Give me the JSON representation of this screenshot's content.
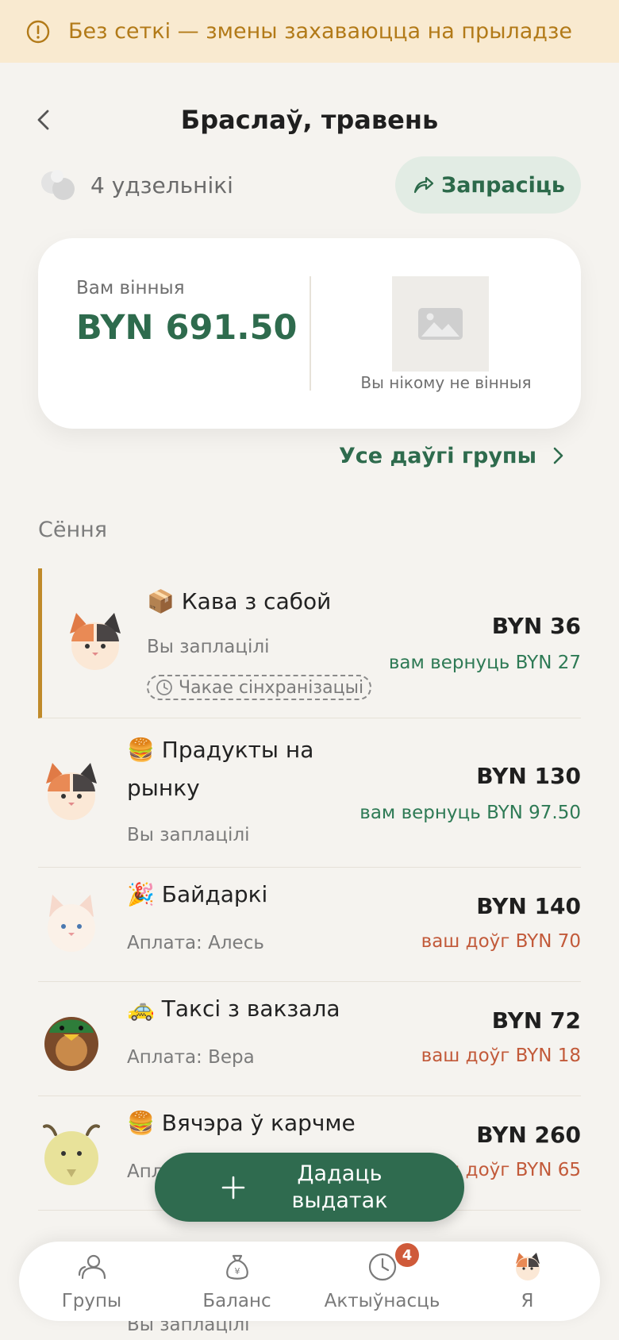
{
  "banner": {
    "text": "Без сеткі — змены захаваюцца на прыладзе"
  },
  "header": {
    "title": "Браслаў, травень"
  },
  "members": {
    "count_label": "4 удзельнікі",
    "invite_label": "Запрасіць"
  },
  "balance": {
    "owed_label": "Вам вінныя",
    "owed_amount": "BYN 691.50",
    "owe_nobody": "Вы нікому не вінныя"
  },
  "all_debts_label": "Усе даўгі групы",
  "section_today": "Сёння",
  "expenses": [
    {
      "emoji": "📦",
      "title": "Кава з сабой",
      "sub": "Вы заплацілі",
      "amount": "BYN 36",
      "delta": "вам вернуць BYN 27",
      "delta_type": "green",
      "status": "Чакае сінхранізацыі",
      "avatar": "calico-cat"
    },
    {
      "emoji": "🍔",
      "title": "Прадукты на рынку",
      "sub": "Вы заплацілі",
      "amount": "BYN 130",
      "delta": "вам вернуць BYN 97.50",
      "delta_type": "green",
      "avatar": "calico-cat"
    },
    {
      "emoji": "🎉",
      "title": "Байдаркі",
      "sub": "Аплата: Алесь",
      "amount": "BYN 140",
      "delta": "ваш доўг BYN 70",
      "delta_type": "red",
      "avatar": "white-cat"
    },
    {
      "emoji": "🚕",
      "title": "Таксі з вакзала",
      "sub": "Аплата: Вера",
      "amount": "BYN 72",
      "delta": "ваш доўг BYN 18",
      "delta_type": "red",
      "avatar": "duck-owl"
    },
    {
      "emoji": "🍔",
      "title": "Вячэра ў карчме",
      "sub": "Аплата: Алесь",
      "amount": "BYN 260",
      "delta": "ваш доўг BYN 65",
      "delta_type": "red",
      "avatar": "goat"
    }
  ],
  "peek_sub": "Вы заплацілі",
  "fab": {
    "label": "Дадаць выдатак"
  },
  "tabs": [
    {
      "label": "Групы",
      "icon": "people-icon"
    },
    {
      "label": "Баланс",
      "icon": "money-bag-icon"
    },
    {
      "label": "Актыўнасць",
      "icon": "clock-icon",
      "badge": "4"
    },
    {
      "label": "Я",
      "icon": "profile-avatar-icon"
    }
  ],
  "colors": {
    "accent": "#2e6b4d",
    "banner_bg": "#f9ead0",
    "banner_text": "#b27a18",
    "negative": "#c25a3a",
    "pending_bar": "#c08a2a"
  }
}
